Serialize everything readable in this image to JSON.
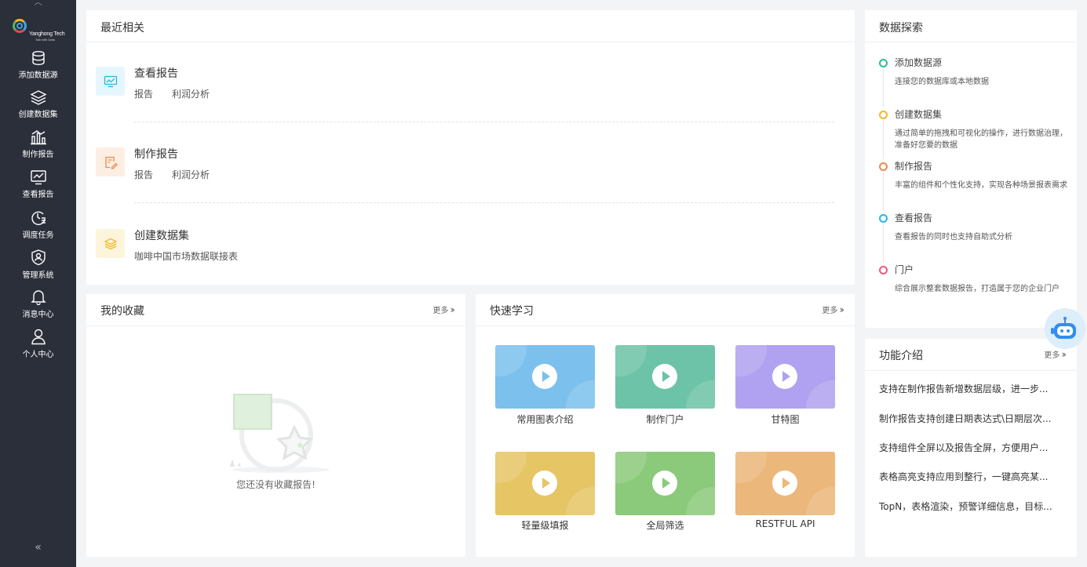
{
  "sidebar": {
    "logo_text": "Yanghong Tech",
    "logo_sub": "Talk with Data",
    "items": [
      {
        "label": "添加数据源",
        "icon": "database-icon"
      },
      {
        "label": "创建数据集",
        "icon": "layers-icon"
      },
      {
        "label": "制作报告",
        "icon": "bar-chart-icon"
      },
      {
        "label": "查看报告",
        "icon": "monitor-chart-icon"
      },
      {
        "label": "调度任务",
        "icon": "schedule-clock-icon"
      },
      {
        "label": "管理系统",
        "icon": "shield-user-icon"
      },
      {
        "label": "消息中心",
        "icon": "bell-icon"
      },
      {
        "label": "个人中心",
        "icon": "user-icon"
      }
    ],
    "collapse_glyph": "«",
    "up_glyph": "︿"
  },
  "recent": {
    "title": "最近相关",
    "items": [
      {
        "title": "查看报告",
        "tags": [
          "报告",
          "利润分析"
        ],
        "icon": "monitor-chart-icon",
        "color": "#29b6e8",
        "bg": "#e6f6fd"
      },
      {
        "title": "制作报告",
        "tags": [
          "报告",
          "利润分析"
        ],
        "icon": "edit-document-icon",
        "color": "#f08a4b",
        "bg": "#fdeee4"
      },
      {
        "title": "创建数据集",
        "tags": [
          "咖啡中国市场数据联接表"
        ],
        "icon": "layers-icon",
        "color": "#f3b72a",
        "bg": "#fdf4dc"
      }
    ]
  },
  "explore": {
    "title": "数据探索",
    "items": [
      {
        "title": "添加数据源",
        "desc": "连接您的数据库或本地数据",
        "color": "#2bbf8a"
      },
      {
        "title": "创建数据集",
        "desc": "通过简单的拖拽和可视化的操作，进行数据治理，准备好您要的数据",
        "color": "#f3b72a"
      },
      {
        "title": "制作报告",
        "desc": "丰富的组件和个性化支持，实现各种场景报表需求",
        "color": "#f08a4b"
      },
      {
        "title": "查看报告",
        "desc": "查看报告的同时也支持自助式分析",
        "color": "#29b6e8"
      },
      {
        "title": "门户",
        "desc": "综合展示整套数据报告，打造属于您的企业门户",
        "color": "#ee5a7a"
      }
    ]
  },
  "favorites": {
    "title": "我的收藏",
    "more": "更多",
    "empty_text": "您还没有收藏报告!"
  },
  "learn": {
    "title": "快速学习",
    "more": "更多",
    "videos": [
      {
        "label": "常用图表介绍",
        "color": "#7cc0ee"
      },
      {
        "label": "制作门户",
        "color": "#6dc3a7"
      },
      {
        "label": "甘特图",
        "color": "#b0a2f0"
      },
      {
        "label": "轻量级填报",
        "color": "#e6c565"
      },
      {
        "label": "全局筛选",
        "color": "#8bc97b"
      },
      {
        "label": "RESTFUL API",
        "color": "#ecb77a"
      }
    ]
  },
  "features": {
    "title": "功能介绍",
    "more": "更多",
    "items": [
      "支持在制作报告新增数据层级，进一步...",
      "制作报告支持创建日期表达式\\日期层次...",
      "支持组件全屏以及报告全屏，方便用户...",
      "表格高亮支持应用到整行，一键高亮某...",
      "TopN，表格渲染，预警详细信息，目标..."
    ]
  }
}
